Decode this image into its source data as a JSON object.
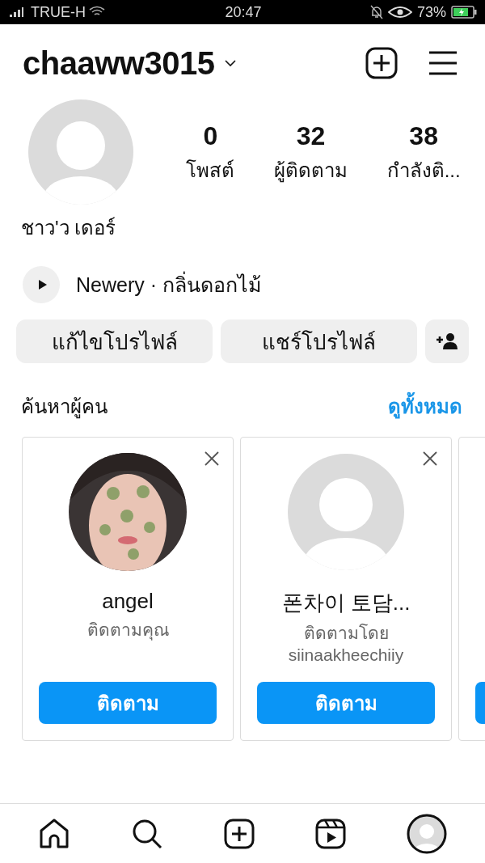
{
  "status_bar": {
    "carrier": "TRUE-H",
    "time": "20:47",
    "battery": "73%"
  },
  "header": {
    "username": "chaaww3015"
  },
  "profile": {
    "display_name": "ชาว'ว เดอร์",
    "stats": [
      {
        "value": "0",
        "label": "โพสต์"
      },
      {
        "value": "32",
        "label": "ผู้ติดตาม"
      },
      {
        "value": "38",
        "label": "กำลังติ..."
      }
    ],
    "music": "Newery · กลิ่นดอกไม้"
  },
  "actions": [
    "แก้ไขโปรไฟล์",
    "แชร์โปรไฟล์"
  ],
  "suggestions": {
    "title": "ค้นหาผู้คน",
    "see_all": "ดูทั้งหมด",
    "cards": [
      {
        "name": "angel",
        "subtitle": "ติดตามคุณ",
        "button": "ติดตาม"
      },
      {
        "kind": "placeholder",
        "name": "폰차이 토담...",
        "subtitle": "ติดตามโดย siinaakheechiiy",
        "button": "ติดตาม"
      },
      {
        "kind": "cut"
      }
    ]
  }
}
